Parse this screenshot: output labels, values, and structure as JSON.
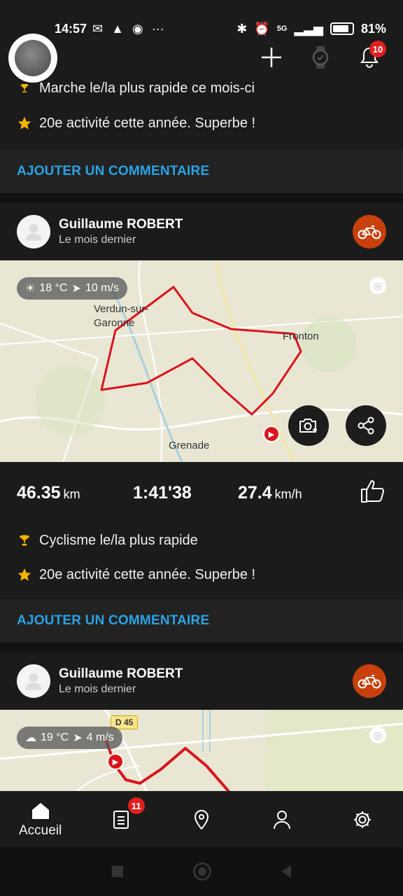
{
  "status_bar": {
    "time": "14:57",
    "battery": "81%",
    "network": "5G"
  },
  "header": {
    "notification_count": "10"
  },
  "feed": {
    "partial_card": {
      "achievement_cut": "Marche le/la plus rapide ce mois-ci",
      "achievement_2": "20e activité cette année. Superbe !",
      "comment_label": "AJOUTER UN COMMENTAIRE"
    },
    "card_1": {
      "user": "Guillaume ROBERT",
      "when": "Le mois dernier",
      "sport_icon": "bike-icon",
      "weather": {
        "temp": "18 °C",
        "wind": "10 m/s"
      },
      "map_labels": {
        "town1": "Verdun-sur-Garonne",
        "town2": "Fronton",
        "town3": "Grenade"
      },
      "stats": {
        "distance": "46.35",
        "distance_unit": "km",
        "duration": "1:41'38",
        "speed": "27.4",
        "speed_unit": "km/h"
      },
      "achievement_1": "Cyclisme le/la plus rapide",
      "achievement_2": "20e activité cette année. Superbe !",
      "comment_label": "AJOUTER UN COMMENTAIRE"
    },
    "card_2": {
      "user": "Guillaume ROBERT",
      "when": "Le mois dernier",
      "sport_icon": "bike-icon",
      "weather": {
        "temp": "19 °C",
        "wind": "4 m/s"
      },
      "map_labels": {
        "road": "D 45"
      }
    }
  },
  "bottom_nav": {
    "home_label": "Accueil",
    "diary_badge": "11"
  },
  "colors": {
    "accent_blue": "#2aa3e6",
    "route_red": "#d9141c",
    "sport_orange": "#c8400b"
  }
}
